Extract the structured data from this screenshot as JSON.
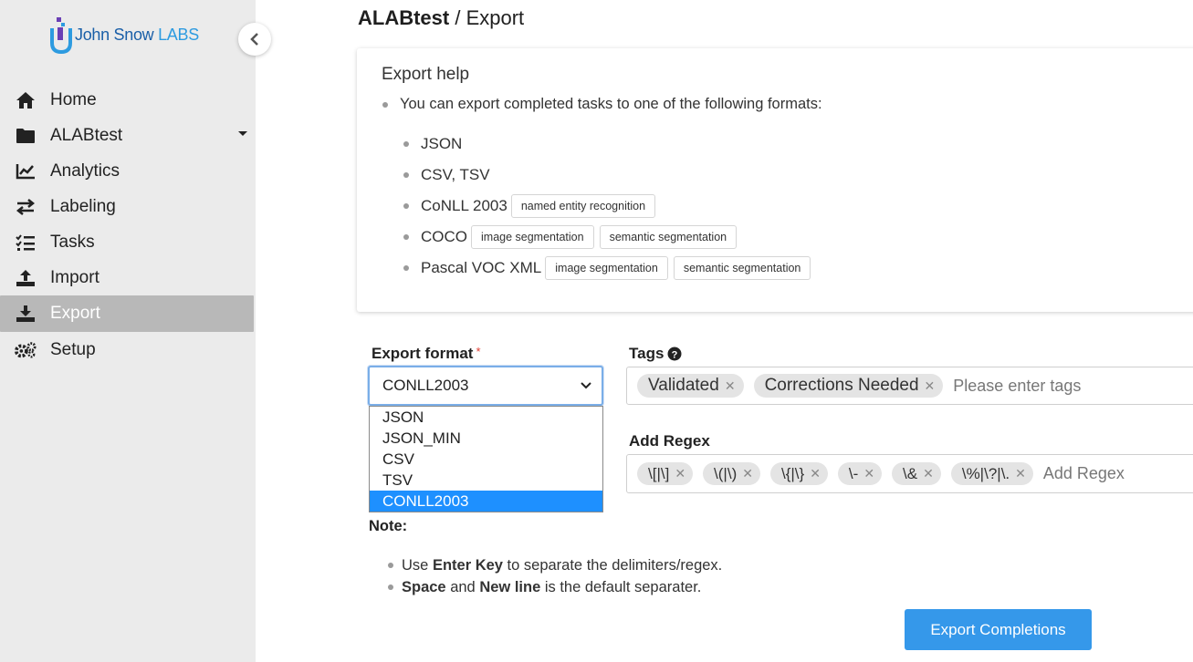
{
  "brand": {
    "name_primary": "John Snow",
    "name_secondary": "LABS"
  },
  "nav": {
    "items": [
      {
        "label": "Home",
        "icon": "home-icon"
      },
      {
        "label": "ALABtest",
        "icon": "folder-icon"
      },
      {
        "label": "Analytics",
        "icon": "analytics-icon"
      },
      {
        "label": "Labeling",
        "icon": "swap-icon"
      },
      {
        "label": "Tasks",
        "icon": "tasks-icon"
      },
      {
        "label": "Import",
        "icon": "upload-icon"
      },
      {
        "label": "Export",
        "icon": "download-icon",
        "active": true
      },
      {
        "label": "Setup",
        "icon": "gears-icon"
      }
    ]
  },
  "header": {
    "project": "ALABtest",
    "separator": " / ",
    "page": "Export"
  },
  "help": {
    "title": "Export help",
    "intro": "You can export completed tasks to one of the following formats:",
    "formats": [
      {
        "name": "JSON",
        "tags": []
      },
      {
        "name": "CSV, TSV",
        "tags": []
      },
      {
        "name": "CoNLL 2003",
        "tags": [
          "named entity recognition"
        ]
      },
      {
        "name": "COCO",
        "tags": [
          "image segmentation",
          "semantic segmentation"
        ]
      },
      {
        "name": "Pascal VOC XML",
        "tags": [
          "image segmentation",
          "semantic segmentation"
        ]
      }
    ]
  },
  "export_format": {
    "label": "Export format",
    "required_mark": "*",
    "selected": "CONLL2003",
    "options": [
      "JSON",
      "JSON_MIN",
      "CSV",
      "TSV",
      "CONLL2003"
    ]
  },
  "tags": {
    "label": "Tags",
    "values": [
      "Validated",
      "Corrections Needed"
    ],
    "placeholder": "Please enter tags"
  },
  "regex": {
    "label": "Add Regex",
    "values": [
      "\\[|\\]",
      "\\(|\\)",
      "\\{|\\}",
      "\\-",
      "\\&",
      "\\%|\\?|\\."
    ],
    "placeholder": "Add Regex"
  },
  "note": {
    "title": "Note:",
    "line1": {
      "pre": "Use ",
      "bold": "Enter Key",
      "post": " to separate the delimiters/regex."
    },
    "line2": {
      "bold1": "Space",
      "mid": " and ",
      "bold2": "New line",
      "post": " is the default separater."
    }
  },
  "actions": {
    "export_label": "Export Completions"
  },
  "colors": {
    "accent": "#3598ea",
    "selected_option": "#1e90ff",
    "sidebar_bg": "#ebebeb",
    "active_nav": "#b8b8b8"
  }
}
